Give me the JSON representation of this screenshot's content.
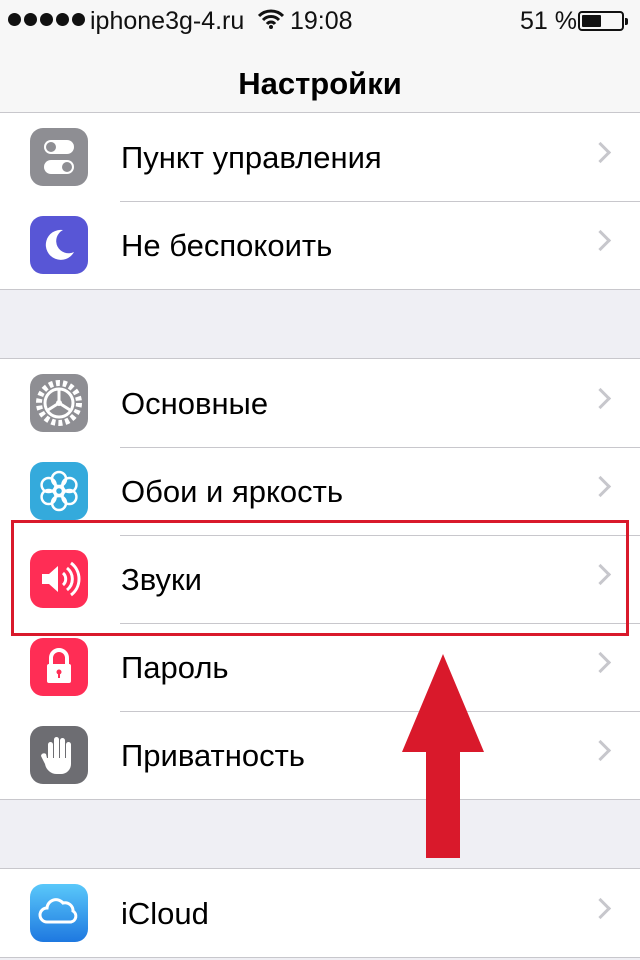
{
  "status_bar": {
    "carrier": "iphone3g-4.ru",
    "time": "19:08",
    "battery_percent": "51 %",
    "battery_level": 0.51,
    "signal_icon": "signal-dots-icon",
    "wifi_icon": "wifi-icon",
    "battery_icon": "battery-icon"
  },
  "nav": {
    "title": "Настройки"
  },
  "groups": [
    {
      "items": [
        {
          "label": "Пункт управления",
          "icon": "control-center-icon",
          "color": "#8e8e93"
        },
        {
          "label": "Не беспокоить",
          "icon": "moon-icon",
          "color": "#5856d6"
        }
      ]
    },
    {
      "items": [
        {
          "label": "Основные",
          "icon": "gear-icon",
          "color": "#8e8e93"
        },
        {
          "label": "Обои и яркость",
          "icon": "flower-icon",
          "color": "#34aadc"
        },
        {
          "label": "Звуки",
          "icon": "speaker-icon",
          "color": "#ff2d55",
          "highlighted": true
        },
        {
          "label": "Пароль",
          "icon": "lock-icon",
          "color": "#ff2d55"
        },
        {
          "label": "Приватность",
          "icon": "hand-icon",
          "color": "#6d6d72"
        }
      ]
    },
    {
      "items": [
        {
          "label": "iCloud",
          "icon": "cloud-icon",
          "color": "#1e90ff"
        }
      ]
    }
  ],
  "annotation": {
    "highlight_color": "#d9192b",
    "arrow_color": "#d9192b"
  }
}
